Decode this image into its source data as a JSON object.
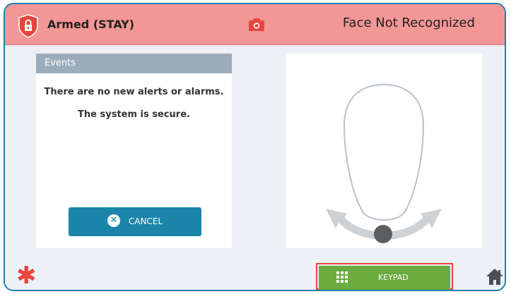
{
  "header": {
    "status_text": "Armed (STAY)",
    "face_status": "Face Not Recognized",
    "status_color": "#f29696",
    "shield_icon": "lock-shield-icon",
    "camera_icon": "camera-icon"
  },
  "events": {
    "title": "Events",
    "messages": [
      "There are no new alerts or alarms.",
      "The system is secure."
    ],
    "cancel_label": "CANCEL",
    "cancel_color": "#1b86a9"
  },
  "face_panel": {
    "icon": "face-outline-icon"
  },
  "footer": {
    "keypad_label": "KEYPAD",
    "keypad_color": "#6bab3f",
    "icons": [
      "asterisk-icon",
      "keypad-grid-icon",
      "home-icon"
    ]
  }
}
